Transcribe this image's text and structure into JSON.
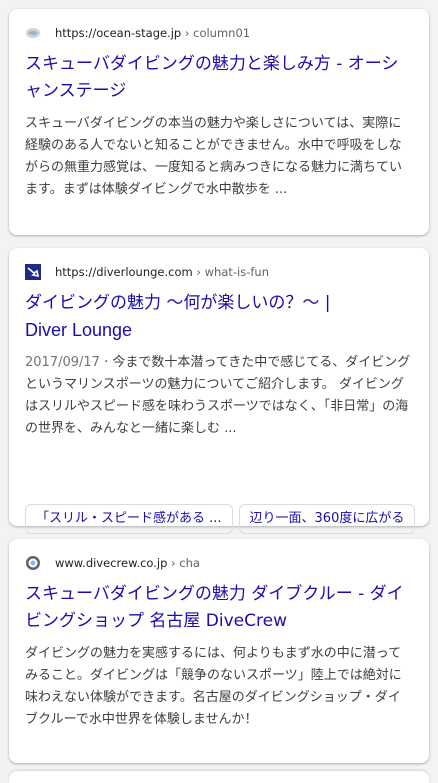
{
  "results": [
    {
      "url_domain": "https://ocean-stage.jp",
      "url_crumb": " › column01",
      "favicon": "ocean-stage-icon",
      "title": "スキューバダイビングの魅力と楽しみ方 - オーシャンステージ",
      "snippet": "スキューバダイビングの本当の魅力や楽しさについては、実際に経験のある人でないと知ることができません。水中で呼吸をしながらの無重力感覚は、一度知ると病みつきになる魅力に満ちています。まずは体験ダイビングで水中散歩を ..."
    },
    {
      "url_domain": "https://diverlounge.com",
      "url_crumb": " › what-is-fun",
      "favicon": "diver-lounge-icon",
      "title_line1": "ダイビングの魅力 ～何が楽しいの？～ |",
      "title_line2": "Diver Lounge",
      "date": "2017/09/17",
      "snippet": " · 今まで数十本潜ってきた中で感じてる、ダイビングというマリンスポーツの魅力についてご紹介します。 ダイビングはスリルやスピード感を味わうスポーツではなく、「非日常」の海の世界を、みんなと一緒に楽しむ ...",
      "chips": [
        "「スリル・スピード感がある ...",
        "辺り一面、360度に広がる"
      ]
    },
    {
      "url_domain": "www.divecrew.co.jp",
      "url_crumb": " › cha",
      "favicon": "globe-icon",
      "title": "スキューバダイビングの魅力 ダイブクルー - ダイビングショップ 名古屋 DiveCrew",
      "snippet": "ダイビングの魅力を実感するには、何よりもまず水の中に潜ってみること。ダイビングは「競争のないスポーツ」陸上では絶対に味わえない体験ができます。名古屋のダイビングショップ・ダイブクルーで水中世界を体験しませんか！"
    }
  ],
  "colors": {
    "link": "#1a0dab",
    "snippet": "#3c4043",
    "background": "#f1f3f4"
  }
}
